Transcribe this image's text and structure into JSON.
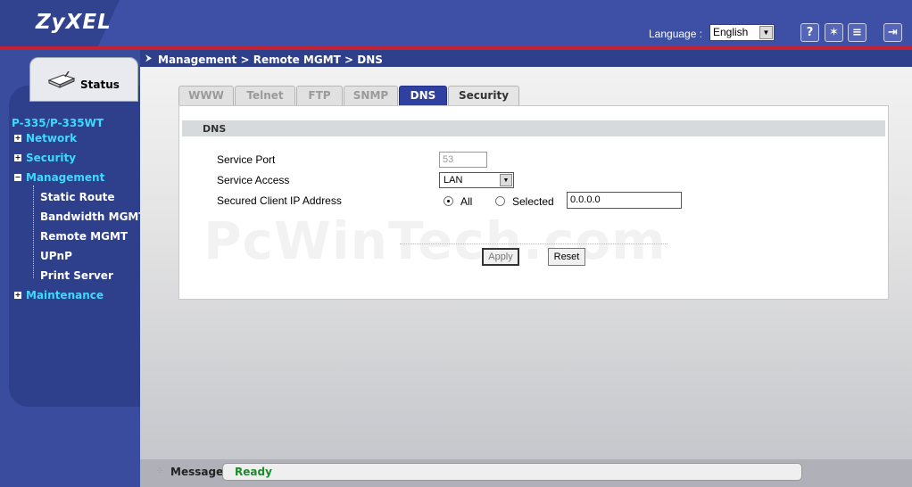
{
  "header": {
    "logo": "ZyXEL",
    "language_label": "Language :",
    "language_value": "English",
    "icons": [
      "help-icon",
      "wizard-icon",
      "sitemap-icon",
      "logout-icon"
    ]
  },
  "sidebar": {
    "status_label": "Status",
    "model": "P-335/P-335WT",
    "items": [
      {
        "label": "Network",
        "expanded": false
      },
      {
        "label": "Security",
        "expanded": false
      },
      {
        "label": "Management",
        "expanded": true
      },
      {
        "label": "Maintenance",
        "expanded": false
      }
    ],
    "management_sub": [
      "Static Route",
      "Bandwidth MGMT",
      "Remote MGMT",
      "UPnP",
      "Print Server"
    ]
  },
  "breadcrumb": "Management > Remote MGMT > DNS",
  "tabs": [
    "WWW",
    "Telnet",
    "FTP",
    "SNMP",
    "DNS",
    "Security"
  ],
  "active_tab": "DNS",
  "section_title": "DNS",
  "form": {
    "service_port_label": "Service Port",
    "service_port_value": "53",
    "service_access_label": "Service Access",
    "service_access_value": "LAN",
    "secured_ip_label": "Secured Client IP Address",
    "radio_all_label": "All",
    "radio_selected_label": "Selected",
    "radio_selected": "All",
    "ip_value": "0.0.0.0",
    "apply_label": "Apply",
    "reset_label": "Reset"
  },
  "watermark": "PcWinTech.com",
  "footer": {
    "message_label": "Message",
    "message_text": "Ready"
  },
  "colors": {
    "header_blue": "#3d50a6",
    "nav_cyan": "#3dd9ff",
    "active_tab": "#3040a0",
    "ready_green": "#1b8a2a"
  }
}
